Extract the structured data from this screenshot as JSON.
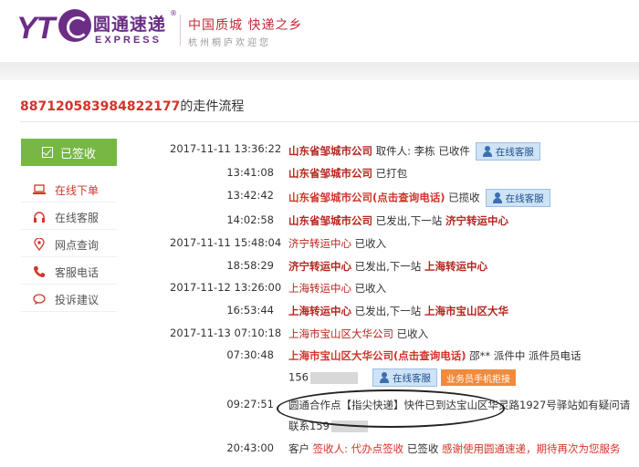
{
  "header": {
    "logo_yt": "YT",
    "logo_cn": "圆通速递",
    "logo_reg": "®",
    "logo_en": "EXPRESS",
    "slogan": "中国质城 快递之乡",
    "slogan_sub": "杭州桐庐欢迎您"
  },
  "page": {
    "tracking_number": "887120583984822177",
    "title_suffix": "的走件流程"
  },
  "sidebar": {
    "active_label": "已签收",
    "items": [
      {
        "label": "在线下单",
        "icon": "laptop-icon"
      },
      {
        "label": "在线客服",
        "icon": "headset-icon"
      },
      {
        "label": "网点查询",
        "icon": "location-pin-icon"
      },
      {
        "label": "客服电话",
        "icon": "phone-icon"
      },
      {
        "label": "投诉建议",
        "icon": "chat-bubble-icon"
      }
    ]
  },
  "buttons": {
    "online_service": "在线客服",
    "courier_phone": "业务员手机拒接"
  },
  "events": [
    {
      "date": "2017-11-11",
      "time": "13:36:22",
      "a": "山东省邹城市公司",
      "b": " 取件人: 李栋 已收件"
    },
    {
      "time": "13:41:08",
      "a": "山东省邹城市公司",
      "b": " 已打包"
    },
    {
      "time": "13:42:42",
      "a": "山东省邹城市公司(点击查询电话)",
      "b": " 已揽收"
    },
    {
      "time": "14:02:58",
      "a": "山东省邹城市公司",
      "b": " 已发出,下一站 ",
      "c": "济宁转运中心"
    },
    {
      "date": "2017-11-11",
      "time": "15:48:04",
      "a": "济宁转运中心",
      "b": " 已收入"
    },
    {
      "time": "18:58:29",
      "a": "济宁转运中心",
      "b": " 已发出,下一站 ",
      "c": "上海转运中心"
    },
    {
      "date": "2017-11-12",
      "time": "13:26:00",
      "a": "上海转运中心",
      "b": " 已收入"
    },
    {
      "time": "16:53:44",
      "a": "上海转运中心",
      "b": " 已发出,下一站 ",
      "c": "上海市宝山区大华"
    },
    {
      "date": "2017-11-13",
      "time": "07:10:18",
      "a": "上海市宝山区大华公司",
      "b": " 已收入"
    },
    {
      "time": "07:30:48",
      "a": "上海市宝山区大华公司(点击查询电话)",
      "b": " 邵** 派件中 派件员电话",
      "c": "156"
    },
    {
      "time": "09:27:51",
      "a": "圆通合作点【指尖快递】快件已到达宝山区华灵路1927号驿站",
      "b": "如有疑问请",
      "c": "联系159"
    },
    {
      "time": "20:43:00",
      "a": "客户 ",
      "b": "签收人: 代办点签收",
      "c": " 已签收 ",
      "d": "感谢使用圆通速递，期待再次为您服务"
    }
  ]
}
